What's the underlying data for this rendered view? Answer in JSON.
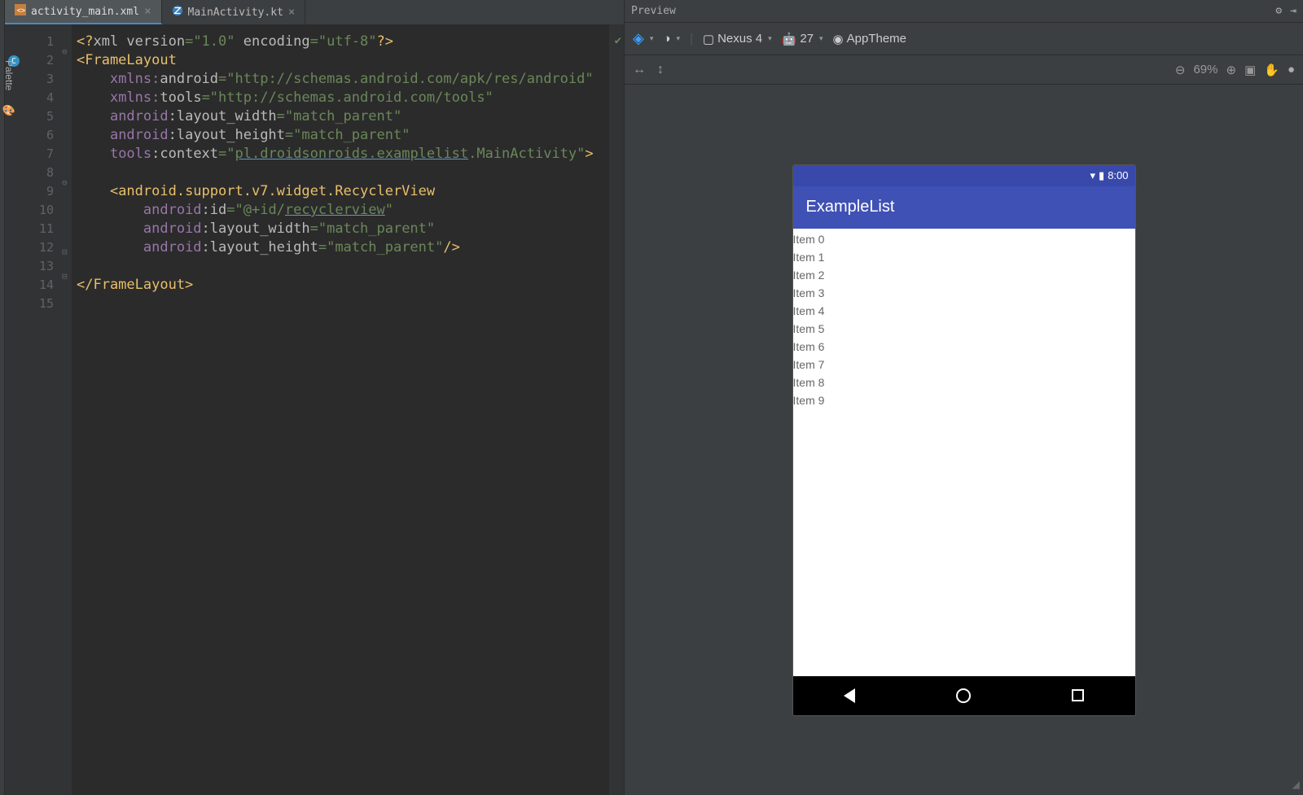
{
  "tabs": [
    {
      "name": "activity_main.xml",
      "active": true
    },
    {
      "name": "MainActivity.kt",
      "active": false
    }
  ],
  "lines": [
    "1",
    "2",
    "3",
    "4",
    "5",
    "6",
    "7",
    "8",
    "9",
    "10",
    "11",
    "12",
    "13",
    "14",
    "15"
  ],
  "code": {
    "l1a": "<?",
    "l1b": "xml version",
    "l1c": "=\"1.0\" ",
    "l1d": "encoding",
    "l1e": "=\"utf-8\"",
    "l1f": "?>",
    "l2a": "<FrameLayout",
    "l3a": "xmlns:",
    "l3b": "android",
    "l3c": "=\"http://schemas.android.com/apk/res/android\"",
    "l4a": "xmlns:",
    "l4b": "tools",
    "l4c": "=\"http://schemas.android.com/tools\"",
    "l5a": "android",
    "l5b": ":layout_width",
    "l5c": "=\"match_parent\"",
    "l6a": "android",
    "l6b": ":layout_height",
    "l6c": "=\"match_parent\"",
    "l7a": "tools",
    "l7b": ":context",
    "l7c": "=\"",
    "l7d": "pl.droidsonroids.examplelist",
    "l7e": ".MainActivity\"",
    "l7f": ">",
    "l9a": "<android.support.v7.widget.RecyclerView",
    "l10a": "android",
    "l10b": ":id",
    "l10c": "=\"@+id/",
    "l10d": "recyclerview",
    "l10e": "\"",
    "l11a": "android",
    "l11b": ":layout_width",
    "l11c": "=\"match_parent\"",
    "l12a": "android",
    "l12b": ":layout_height",
    "l12c": "=\"match_parent\"",
    "l12d": "/>",
    "l14a": "</FrameLayout>"
  },
  "preview": {
    "title": "Preview",
    "palette": "Palette",
    "device": "Nexus 4",
    "api": "27",
    "theme": "AppTheme",
    "zoom": "69%",
    "gutter_badge": "C"
  },
  "app": {
    "time": "8:00",
    "title": "ExampleList",
    "items": [
      "Item 0",
      "Item 1",
      "Item 2",
      "Item 3",
      "Item 4",
      "Item 5",
      "Item 6",
      "Item 7",
      "Item 8",
      "Item 9"
    ]
  }
}
